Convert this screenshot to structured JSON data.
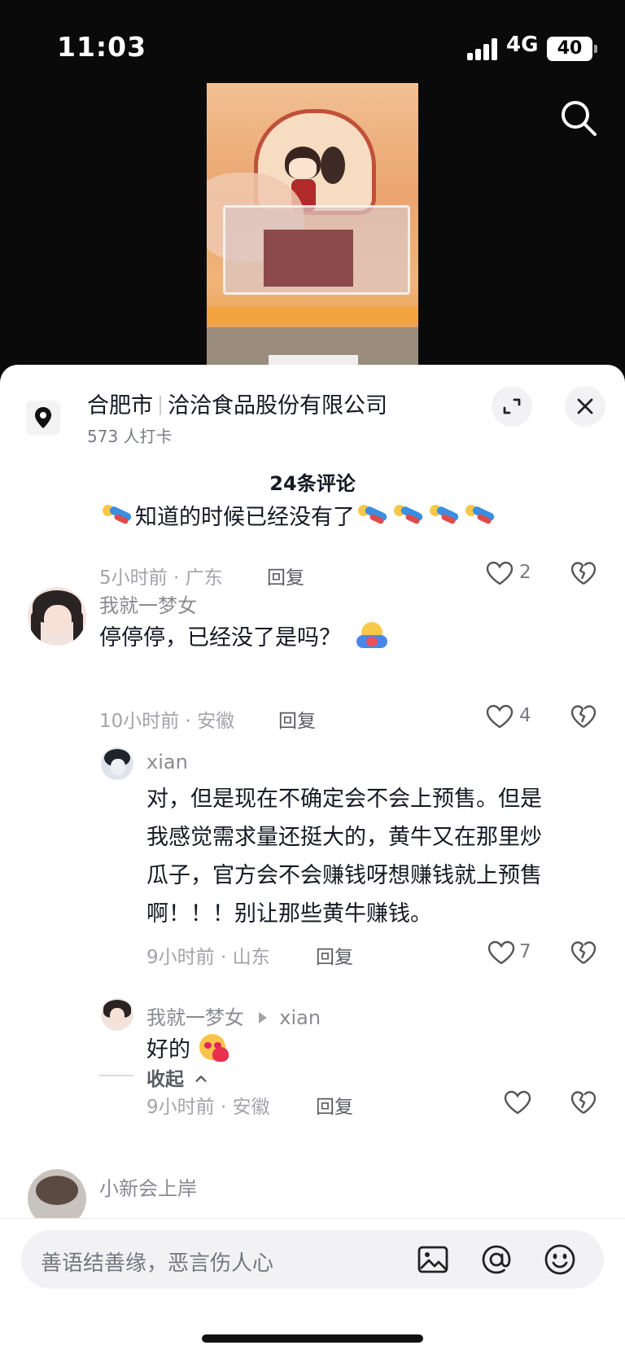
{
  "status_bar": {
    "time": "11:03",
    "network": "4G",
    "battery": "40"
  },
  "location": {
    "city": "合肥市",
    "name": "洽洽食品股份有限公司",
    "checkins": "573 人打卡"
  },
  "comments_header": "24条评论",
  "comments": [
    {
      "text": "知道的时候已经没有了",
      "time_location": "5小时前 · 广东",
      "reply_label": "回复",
      "likes": "2"
    },
    {
      "username": "我就一梦女",
      "text": "停停停，已经没了是吗？",
      "time_location": "10小时前 · 安徽",
      "reply_label": "回复",
      "likes": "4",
      "replies": [
        {
          "username": "xian",
          "text_lines": [
            "对，但是现在不确定会不会上预售。但是",
            "我感觉需求量还挺大的，黄牛又在那里炒",
            "瓜子，官方会不会赚钱呀想赚钱就上预售",
            "啊！！！别让那些黄牛赚钱。"
          ],
          "time_location": "9小时前 · 山东",
          "reply_label": "回复",
          "likes": "7"
        },
        {
          "username": "我就一梦女",
          "reply_to": "xian",
          "text": "好的",
          "time_location": "9小时前 · 安徽",
          "reply_label": "回复",
          "likes": ""
        }
      ]
    },
    {
      "username": "小新会上岸"
    }
  ],
  "collapse_label": "收起",
  "input": {
    "placeholder": "善语结善缘，恶言伤人心"
  }
}
